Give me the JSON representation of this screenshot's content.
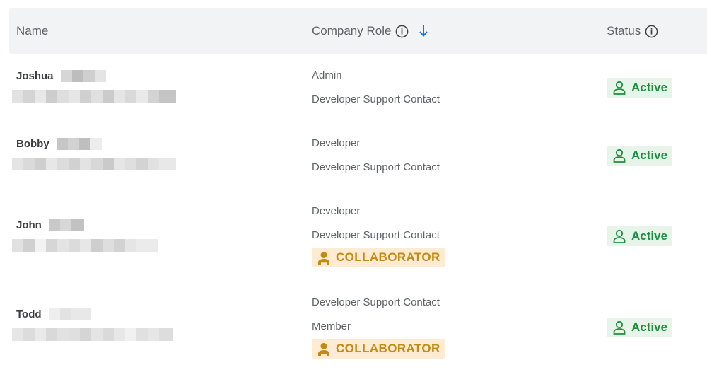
{
  "table": {
    "headers": {
      "name": "Name",
      "company_role": "Company Role",
      "status": "Status"
    },
    "rows": [
      {
        "first_name": "Joshua",
        "roles": [
          "Admin",
          "Developer Support Contact"
        ],
        "collaborator": "",
        "status": "Active"
      },
      {
        "first_name": "Bobby",
        "roles": [
          "Developer",
          "Developer Support Contact"
        ],
        "collaborator": "",
        "status": "Active"
      },
      {
        "first_name": "John",
        "roles": [
          "Developer",
          "Developer Support Contact"
        ],
        "collaborator": "COLLABORATOR",
        "status": "Active"
      },
      {
        "first_name": "Todd",
        "roles": [
          "Developer Support Contact",
          "Member"
        ],
        "collaborator": "COLLABORATOR",
        "status": "Active"
      }
    ]
  },
  "icons": {
    "header_info": "info-circle-icon",
    "sort": "arrow-down-icon",
    "status": "person-outline-icon",
    "collaborator": "person-filled-icon"
  },
  "colors": {
    "header_bg": "#f1f3f4",
    "active_text": "#1e8e3e",
    "active_bg": "#e6f4ea",
    "collaborator_text": "#c28a13",
    "collaborator_bg": "#fdecd2",
    "sort_arrow": "#1a73e8"
  }
}
